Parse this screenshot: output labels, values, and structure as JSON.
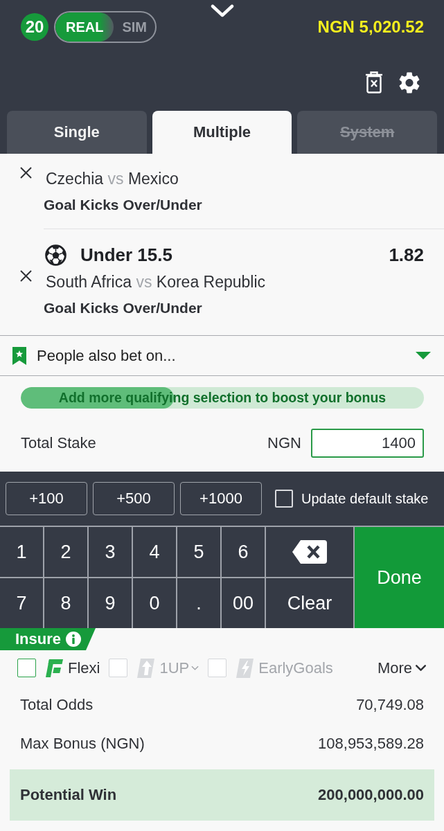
{
  "header": {
    "bet_count": "20",
    "modes": [
      {
        "label": "REAL",
        "selected": true
      },
      {
        "label": "SIM",
        "selected": false
      }
    ],
    "balance": "NGN 5,020.52"
  },
  "tabs": [
    {
      "label": "Single",
      "selected": false,
      "disabled": false
    },
    {
      "label": "Multiple",
      "selected": true,
      "disabled": false
    },
    {
      "label": "System",
      "selected": false,
      "disabled": true
    }
  ],
  "selections": [
    {
      "home": "Czechia",
      "vs": "vs",
      "away": "Mexico",
      "market": "Goal Kicks Over/Under"
    },
    {
      "pick": "Under 15.5",
      "odds": "1.82",
      "home": "South Africa",
      "vs": "vs",
      "away": "Korea Republic",
      "market": "Goal Kicks Over/Under"
    }
  ],
  "people_also_bet_on": {
    "label": "People also bet on..."
  },
  "bonus": {
    "message": "Add more qualifying selection to boost your bonus",
    "level": 0.38
  },
  "stake": {
    "label": "Total Stake",
    "currency": "NGN",
    "value": "1400"
  },
  "quick_stakes": [
    "+100",
    "+500",
    "+1000"
  ],
  "update_default_stake": {
    "label": "Update default stake",
    "checked": false
  },
  "keypad": {
    "keys": [
      {
        "kind": "digit",
        "label": "1"
      },
      {
        "kind": "digit",
        "label": "2"
      },
      {
        "kind": "digit",
        "label": "3"
      },
      {
        "kind": "digit",
        "label": "4"
      },
      {
        "kind": "digit",
        "label": "5"
      },
      {
        "kind": "digit",
        "label": "6"
      },
      {
        "kind": "backspace"
      },
      {
        "kind": "digit",
        "label": "7"
      },
      {
        "kind": "digit",
        "label": "8"
      },
      {
        "kind": "digit",
        "label": "9"
      },
      {
        "kind": "digit",
        "label": "0"
      },
      {
        "kind": "digit",
        "label": "."
      },
      {
        "kind": "digit",
        "label": "00"
      },
      {
        "kind": "clear",
        "label": "Clear"
      }
    ],
    "done": "Done"
  },
  "insure": {
    "label": "Insure",
    "options": [
      {
        "kind": "flexi",
        "label": "Flexi",
        "checked": false,
        "disabled": false,
        "dropdown": false
      },
      {
        "kind": "one_up",
        "label": "1UP",
        "checked": false,
        "disabled": true,
        "dropdown": true
      },
      {
        "kind": "early_goals",
        "label": "EarlyGoals",
        "checked": false,
        "disabled": true,
        "dropdown": false
      }
    ],
    "more": "More"
  },
  "summary": [
    {
      "label": "Total Odds",
      "value": "70,749.08",
      "highlighted": false
    },
    {
      "label": "Max Bonus (NGN)",
      "value": "108,953,589.28",
      "highlighted": false
    },
    {
      "label": "Potential Win",
      "value": "200,000,000.00",
      "highlighted": true
    }
  ]
}
